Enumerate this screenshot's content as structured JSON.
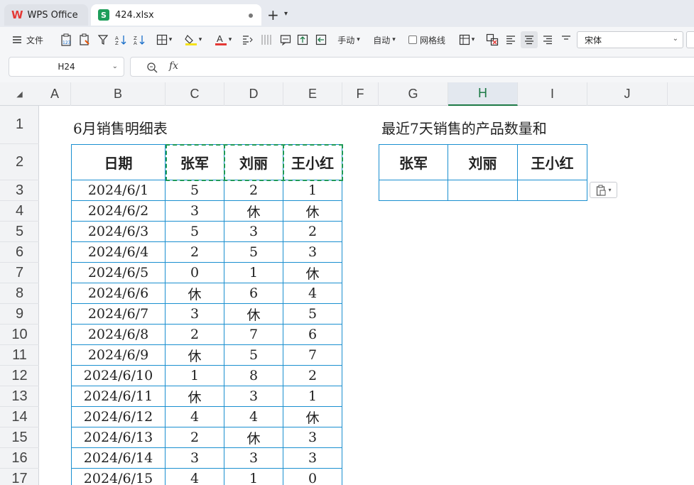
{
  "tabs": {
    "wps_label": "WPS Office",
    "file_label": "424.xlsx",
    "file_icon_letter": "S",
    "new_tab": "+"
  },
  "toolbar": {
    "file_menu": "文件",
    "handfill": "手动",
    "autofill": "自动",
    "gridlines_label": "网格线",
    "font_name": "宋体"
  },
  "formula_bar": {
    "cell_ref": "H24",
    "fx_label": "fx",
    "formula": ""
  },
  "grid": {
    "columns": [
      "A",
      "B",
      "C",
      "D",
      "E",
      "F",
      "G",
      "H",
      "I",
      "J"
    ],
    "selected_column": "H",
    "rows": [
      "1",
      "2",
      "3",
      "4",
      "5",
      "6",
      "7",
      "8",
      "9",
      "10",
      "11",
      "12",
      "13",
      "14",
      "15",
      "16",
      "17"
    ]
  },
  "sheet": {
    "table1_title": "6月销售明细表",
    "table1_headers": [
      "日期",
      "张军",
      "刘丽",
      "王小红"
    ],
    "table1_rows": [
      [
        "2024/6/1",
        "5",
        "2",
        "1"
      ],
      [
        "2024/6/2",
        "3",
        "休",
        "休"
      ],
      [
        "2024/6/3",
        "5",
        "3",
        "2"
      ],
      [
        "2024/6/4",
        "2",
        "5",
        "3"
      ],
      [
        "2024/6/5",
        "0",
        "1",
        "休"
      ],
      [
        "2024/6/6",
        "休",
        "6",
        "4"
      ],
      [
        "2024/6/7",
        "3",
        "休",
        "5"
      ],
      [
        "2024/6/8",
        "2",
        "7",
        "6"
      ],
      [
        "2024/6/9",
        "休",
        "5",
        "7"
      ],
      [
        "2024/6/10",
        "1",
        "8",
        "2"
      ],
      [
        "2024/6/11",
        "休",
        "3",
        "1"
      ],
      [
        "2024/6/12",
        "4",
        "4",
        "休"
      ],
      [
        "2024/6/13",
        "2",
        "休",
        "3"
      ],
      [
        "2024/6/14",
        "3",
        "3",
        "3"
      ],
      [
        "2024/6/15",
        "4",
        "1",
        "0"
      ]
    ],
    "table2_title": "最近7天销售的产品数量和",
    "table2_headers": [
      "张军",
      "刘丽",
      "王小红"
    ],
    "table2_row": [
      "",
      "",
      ""
    ]
  },
  "colors": {
    "accent_green": "#1d7a46",
    "table_border": "#1a8fd0",
    "copy_marquee": "#1f9a57",
    "wps_red": "#e53935"
  }
}
